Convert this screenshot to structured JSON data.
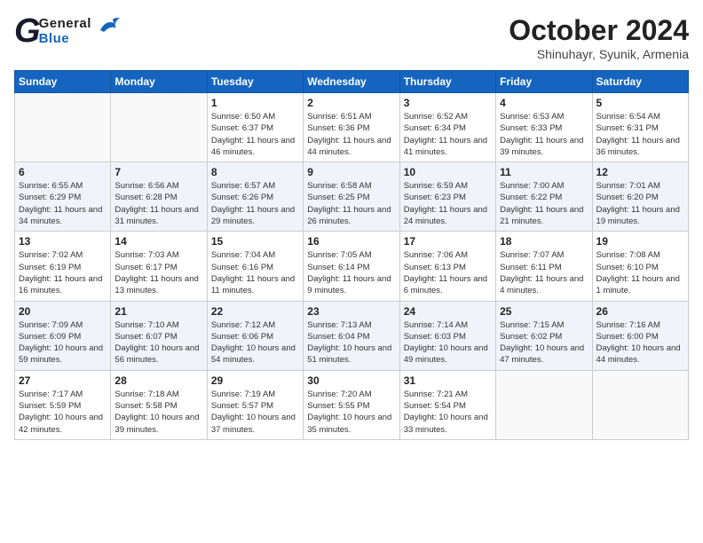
{
  "header": {
    "logo_general": "General",
    "logo_blue": "Blue",
    "month_title": "October 2024",
    "subtitle": "Shinuhayr, Syunik, Armenia"
  },
  "weekdays": [
    "Sunday",
    "Monday",
    "Tuesday",
    "Wednesday",
    "Thursday",
    "Friday",
    "Saturday"
  ],
  "weeks": [
    [
      {
        "day": "",
        "info": ""
      },
      {
        "day": "",
        "info": ""
      },
      {
        "day": "1",
        "info": "Sunrise: 6:50 AM\nSunset: 6:37 PM\nDaylight: 11 hours and 46 minutes."
      },
      {
        "day": "2",
        "info": "Sunrise: 6:51 AM\nSunset: 6:36 PM\nDaylight: 11 hours and 44 minutes."
      },
      {
        "day": "3",
        "info": "Sunrise: 6:52 AM\nSunset: 6:34 PM\nDaylight: 11 hours and 41 minutes."
      },
      {
        "day": "4",
        "info": "Sunrise: 6:53 AM\nSunset: 6:33 PM\nDaylight: 11 hours and 39 minutes."
      },
      {
        "day": "5",
        "info": "Sunrise: 6:54 AM\nSunset: 6:31 PM\nDaylight: 11 hours and 36 minutes."
      }
    ],
    [
      {
        "day": "6",
        "info": "Sunrise: 6:55 AM\nSunset: 6:29 PM\nDaylight: 11 hours and 34 minutes."
      },
      {
        "day": "7",
        "info": "Sunrise: 6:56 AM\nSunset: 6:28 PM\nDaylight: 11 hours and 31 minutes."
      },
      {
        "day": "8",
        "info": "Sunrise: 6:57 AM\nSunset: 6:26 PM\nDaylight: 11 hours and 29 minutes."
      },
      {
        "day": "9",
        "info": "Sunrise: 6:58 AM\nSunset: 6:25 PM\nDaylight: 11 hours and 26 minutes."
      },
      {
        "day": "10",
        "info": "Sunrise: 6:59 AM\nSunset: 6:23 PM\nDaylight: 11 hours and 24 minutes."
      },
      {
        "day": "11",
        "info": "Sunrise: 7:00 AM\nSunset: 6:22 PM\nDaylight: 11 hours and 21 minutes."
      },
      {
        "day": "12",
        "info": "Sunrise: 7:01 AM\nSunset: 6:20 PM\nDaylight: 11 hours and 19 minutes."
      }
    ],
    [
      {
        "day": "13",
        "info": "Sunrise: 7:02 AM\nSunset: 6:19 PM\nDaylight: 11 hours and 16 minutes."
      },
      {
        "day": "14",
        "info": "Sunrise: 7:03 AM\nSunset: 6:17 PM\nDaylight: 11 hours and 13 minutes."
      },
      {
        "day": "15",
        "info": "Sunrise: 7:04 AM\nSunset: 6:16 PM\nDaylight: 11 hours and 11 minutes."
      },
      {
        "day": "16",
        "info": "Sunrise: 7:05 AM\nSunset: 6:14 PM\nDaylight: 11 hours and 9 minutes."
      },
      {
        "day": "17",
        "info": "Sunrise: 7:06 AM\nSunset: 6:13 PM\nDaylight: 11 hours and 6 minutes."
      },
      {
        "day": "18",
        "info": "Sunrise: 7:07 AM\nSunset: 6:11 PM\nDaylight: 11 hours and 4 minutes."
      },
      {
        "day": "19",
        "info": "Sunrise: 7:08 AM\nSunset: 6:10 PM\nDaylight: 11 hours and 1 minute."
      }
    ],
    [
      {
        "day": "20",
        "info": "Sunrise: 7:09 AM\nSunset: 6:09 PM\nDaylight: 10 hours and 59 minutes."
      },
      {
        "day": "21",
        "info": "Sunrise: 7:10 AM\nSunset: 6:07 PM\nDaylight: 10 hours and 56 minutes."
      },
      {
        "day": "22",
        "info": "Sunrise: 7:12 AM\nSunset: 6:06 PM\nDaylight: 10 hours and 54 minutes."
      },
      {
        "day": "23",
        "info": "Sunrise: 7:13 AM\nSunset: 6:04 PM\nDaylight: 10 hours and 51 minutes."
      },
      {
        "day": "24",
        "info": "Sunrise: 7:14 AM\nSunset: 6:03 PM\nDaylight: 10 hours and 49 minutes."
      },
      {
        "day": "25",
        "info": "Sunrise: 7:15 AM\nSunset: 6:02 PM\nDaylight: 10 hours and 47 minutes."
      },
      {
        "day": "26",
        "info": "Sunrise: 7:16 AM\nSunset: 6:00 PM\nDaylight: 10 hours and 44 minutes."
      }
    ],
    [
      {
        "day": "27",
        "info": "Sunrise: 7:17 AM\nSunset: 5:59 PM\nDaylight: 10 hours and 42 minutes."
      },
      {
        "day": "28",
        "info": "Sunrise: 7:18 AM\nSunset: 5:58 PM\nDaylight: 10 hours and 39 minutes."
      },
      {
        "day": "29",
        "info": "Sunrise: 7:19 AM\nSunset: 5:57 PM\nDaylight: 10 hours and 37 minutes."
      },
      {
        "day": "30",
        "info": "Sunrise: 7:20 AM\nSunset: 5:55 PM\nDaylight: 10 hours and 35 minutes."
      },
      {
        "day": "31",
        "info": "Sunrise: 7:21 AM\nSunset: 5:54 PM\nDaylight: 10 hours and 33 minutes."
      },
      {
        "day": "",
        "info": ""
      },
      {
        "day": "",
        "info": ""
      }
    ]
  ]
}
